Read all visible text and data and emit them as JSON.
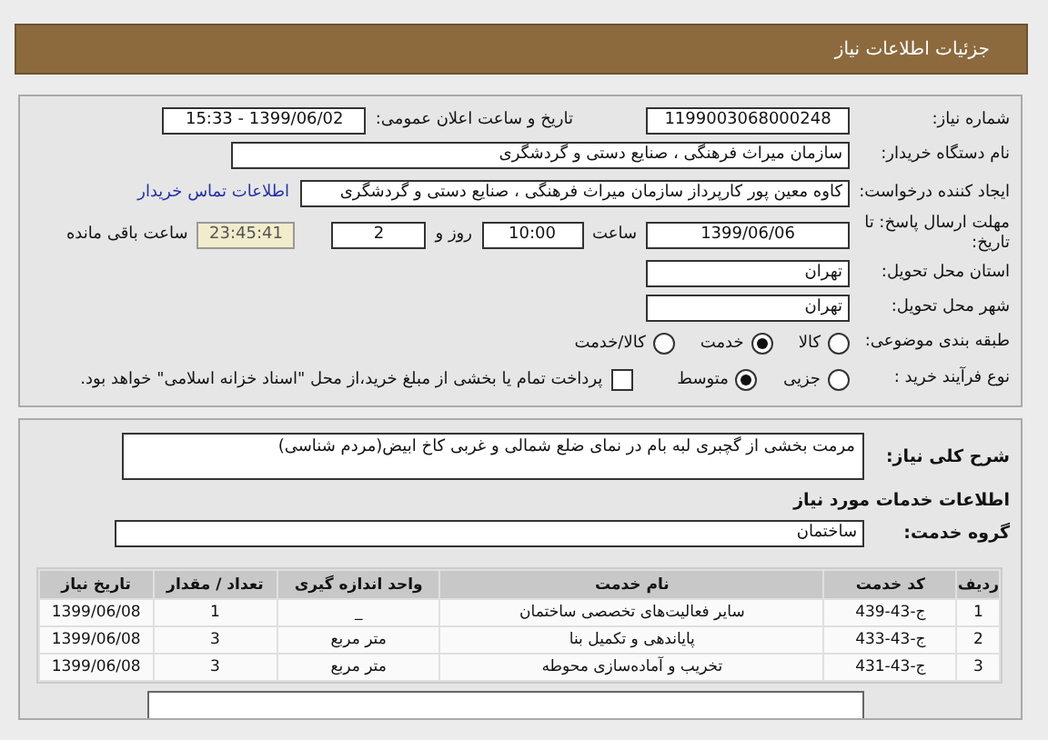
{
  "header": {
    "title": "جزئیات اطلاعات نیاز"
  },
  "need_number": {
    "label": "شماره نیاز:",
    "value": "1199003068000248"
  },
  "announce": {
    "label": "تاریخ و ساعت اعلان عمومی:",
    "value": "1399/06/02 - 15:33"
  },
  "buyer": {
    "label": "نام دستگاه خریدار:",
    "value": "سازمان میراث فرهنگی ، صنایع دستی و گردشگری"
  },
  "creator": {
    "label": "ایجاد کننده درخواست:",
    "value": "کاوه معین پور کارپرداز سازمان میراث فرهنگی ، صنایع دستی و گردشگری",
    "link": "اطلاعات تماس خریدار"
  },
  "deadline": {
    "label": "مهلت ارسال پاسخ: تا تاریخ:",
    "date": "1399/06/06",
    "time_label": "ساعت",
    "time": "10:00",
    "days": "2",
    "days_label": "روز و",
    "remaining": "23:45:41",
    "remaining_label": "ساعت باقی مانده"
  },
  "province": {
    "label": "استان محل تحویل:",
    "value": "تهران"
  },
  "city": {
    "label": "شهر محل تحویل:",
    "value": "تهران"
  },
  "category": {
    "label": "طبقه بندی موضوعی:",
    "options": [
      {
        "label": "کالا",
        "selected": false
      },
      {
        "label": "خدمت",
        "selected": true
      },
      {
        "label": "کالا/خدمت",
        "selected": false
      }
    ]
  },
  "process": {
    "label": "نوع فرآیند خرید :",
    "options": [
      {
        "kind": "radio",
        "label": "جزیی",
        "selected": false
      },
      {
        "kind": "radio",
        "label": "متوسط",
        "selected": true
      },
      {
        "kind": "checkbox",
        "label": "پرداخت تمام یا بخشی از مبلغ خرید،از محل \"اسناد خزانه اسلامی\" خواهد بود.",
        "checked": false
      }
    ]
  },
  "description": {
    "label": "شرح کلی نیاز:",
    "value": "مرمت بخشی از گچبری لبه بام در نمای ضلع شمالی و غربی کاخ ابیض(مردم شناسی)"
  },
  "services_title": "اطلاعات خدمات مورد نیاز",
  "service_group": {
    "label": "گروه خدمت:",
    "value": "ساختمان"
  },
  "table": {
    "columns": [
      "ردیف",
      "کد خدمت",
      "نام خدمت",
      "واحد اندازه گیری",
      "تعداد / مقدار",
      "تاریخ نیاز"
    ],
    "rows": [
      [
        "1",
        "ج-43-439",
        "سایر فعالیت‌های تخصصی ساختمان",
        "_",
        "1",
        "1399/06/08"
      ],
      [
        "2",
        "ج-43-433",
        "پایاندهی و تکمیل بنا",
        "متر مربع",
        "3",
        "1399/06/08"
      ],
      [
        "3",
        "ج-43-431",
        "تخریب و آماده‌سازی محوطه",
        "متر مربع",
        "3",
        "1399/06/08"
      ]
    ]
  }
}
